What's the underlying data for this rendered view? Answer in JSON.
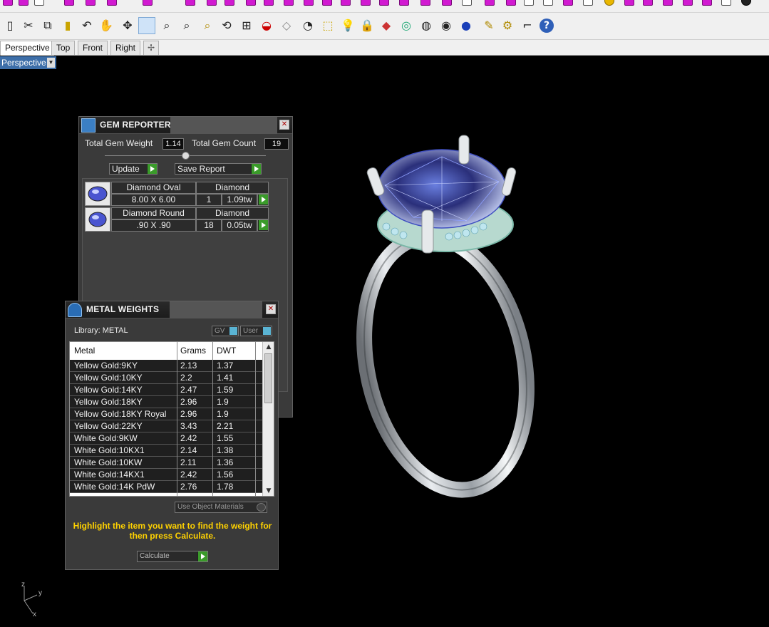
{
  "tabs": [
    "Perspective",
    "Top",
    "Front",
    "Right"
  ],
  "viewport_label": "Perspective",
  "toolbar_icons": [
    "new-icon",
    "cut-icon",
    "copy-icon",
    "paste-icon",
    "undo-icon",
    "pan-hand-icon",
    "rotate-view-icon",
    "select-window-icon",
    "zoom-window-icon",
    "zoom-extents-icon",
    "zoom-target-icon",
    "undo-view-icon",
    "four-view-icon",
    "car-icon",
    "render-icon",
    "cplane-icon",
    "snap-icon",
    "light-icon",
    "lock-icon",
    "material-icon",
    "color-wheel-icon",
    "sphere-wireframe-icon",
    "sphere-shaded-icon",
    "sphere-rendered-icon",
    "pencil-icon",
    "gear-icon",
    "trim-icon",
    "help-icon"
  ],
  "gem_reporter": {
    "title": "GEM REPORTER",
    "total_weight_label": "Total Gem Weight",
    "total_weight_value": "1.14",
    "total_count_label": "Total Gem Count",
    "total_count_value": "19",
    "update_label": "Update",
    "save_report_label": "Save Report",
    "gems": [
      {
        "name": "Diamond Oval",
        "type": "Diamond",
        "size": "8.00 X 6.00",
        "qty": "1",
        "weight": "1.09tw"
      },
      {
        "name": "Diamond Round",
        "type": "Diamond",
        "size": ".90 X .90",
        "qty": "18",
        "weight": "0.05tw"
      }
    ]
  },
  "metal_weights": {
    "title": "METAL WEIGHTS",
    "library_label": "Library: METAL",
    "gv_label": "GV",
    "user_label": "User",
    "columns": [
      "Metal",
      "Grams",
      "DWT"
    ],
    "rows": [
      [
        "Yellow Gold:9KY",
        "2.13",
        "1.37"
      ],
      [
        "Yellow Gold:10KY",
        "2.2",
        "1.41"
      ],
      [
        "Yellow Gold:14KY",
        "2.47",
        "1.59"
      ],
      [
        "Yellow Gold:18KY",
        "2.96",
        "1.9"
      ],
      [
        "Yellow Gold:18KY Royal",
        "2.96",
        "1.9"
      ],
      [
        "Yellow Gold:22KY",
        "3.43",
        "2.21"
      ],
      [
        "White Gold:9KW",
        "2.42",
        "1.55"
      ],
      [
        "White Gold:10KX1",
        "2.14",
        "1.38"
      ],
      [
        "White Gold:10KW",
        "2.11",
        "1.36"
      ],
      [
        "White Gold:14KX1",
        "2.42",
        "1.56"
      ],
      [
        "White Gold:14K PdW",
        "2.76",
        "1.78"
      ]
    ],
    "use_object_materials_label": "Use Object Materials",
    "hint": "Highlight the item you want to find the weight for then press Calculate.",
    "calculate_label": "Calculate"
  },
  "axis": {
    "z": "z",
    "y": "y",
    "x": "x"
  }
}
